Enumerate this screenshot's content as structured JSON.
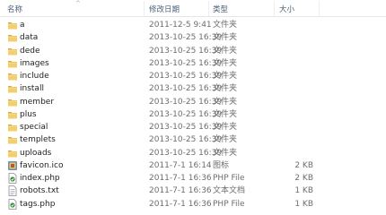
{
  "columns": {
    "name": "名称",
    "date": "修改日期",
    "type": "类型",
    "size": "大小"
  },
  "files": [
    {
      "name": "a",
      "date": "2011-12-5 9:41",
      "type": "文件夹",
      "size": "",
      "icon": "folder-icon"
    },
    {
      "name": "data",
      "date": "2013-10-25 16:39",
      "type": "文件夹",
      "size": "",
      "icon": "folder-icon"
    },
    {
      "name": "dede",
      "date": "2013-10-25 16:39",
      "type": "文件夹",
      "size": "",
      "icon": "folder-icon"
    },
    {
      "name": "images",
      "date": "2013-10-25 16:39",
      "type": "文件夹",
      "size": "",
      "icon": "folder-icon"
    },
    {
      "name": "include",
      "date": "2013-10-25 16:39",
      "type": "文件夹",
      "size": "",
      "icon": "folder-icon"
    },
    {
      "name": "install",
      "date": "2013-10-25 16:39",
      "type": "文件夹",
      "size": "",
      "icon": "folder-icon"
    },
    {
      "name": "member",
      "date": "2013-10-25 16:39",
      "type": "文件夹",
      "size": "",
      "icon": "folder-icon"
    },
    {
      "name": "plus",
      "date": "2013-10-25 16:39",
      "type": "文件夹",
      "size": "",
      "icon": "folder-icon"
    },
    {
      "name": "special",
      "date": "2013-10-25 16:39",
      "type": "文件夹",
      "size": "",
      "icon": "folder-icon"
    },
    {
      "name": "templets",
      "date": "2013-10-25 16:39",
      "type": "文件夹",
      "size": "",
      "icon": "folder-icon"
    },
    {
      "name": "uploads",
      "date": "2013-10-25 16:39",
      "type": "文件夹",
      "size": "",
      "icon": "folder-icon"
    },
    {
      "name": "favicon.ico",
      "date": "2011-7-1 16:14",
      "type": "图标",
      "size": "2 KB",
      "icon": "favicon-icon"
    },
    {
      "name": "index.php",
      "date": "2011-7-1 16:36",
      "type": "PHP File",
      "size": "2 KB",
      "icon": "php-file-icon"
    },
    {
      "name": "robots.txt",
      "date": "2011-7-1 16:36",
      "type": "文本文档",
      "size": "1 KB",
      "icon": "text-file-icon"
    },
    {
      "name": "tags.php",
      "date": "2011-7-1 16:36",
      "type": "PHP File",
      "size": "1 KB",
      "icon": "php-file-icon"
    }
  ],
  "colors": {
    "folder": "#e8c15b",
    "header_text": "#4c607a",
    "php_green": "#3a8a3a"
  }
}
